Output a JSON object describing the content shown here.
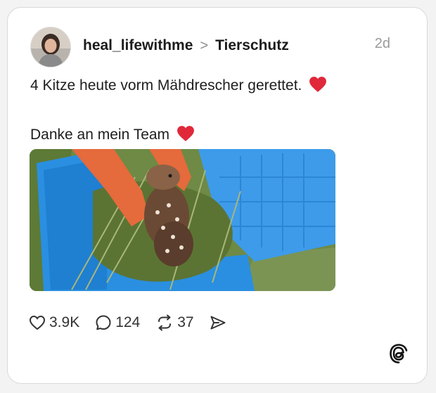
{
  "post": {
    "username": "heal_lifewithme",
    "separator": ">",
    "community": "Tierschutz",
    "time": "2d",
    "line1": "4 Kitze heute vorm Mähdrescher gerettet.",
    "line2": "Danke an mein Team",
    "emoji": "heart-emoji"
  },
  "actions": {
    "likes": "3.9K",
    "comments": "124",
    "reposts": "37"
  },
  "icons": {
    "like": "heart-icon",
    "comment": "speech-bubble-icon",
    "repost": "repost-icon",
    "share": "send-icon",
    "brand": "threads-logo-icon"
  },
  "colors": {
    "heart": "#e0283a",
    "crate": "#2a8fe0",
    "text": "#1e1e1e"
  }
}
